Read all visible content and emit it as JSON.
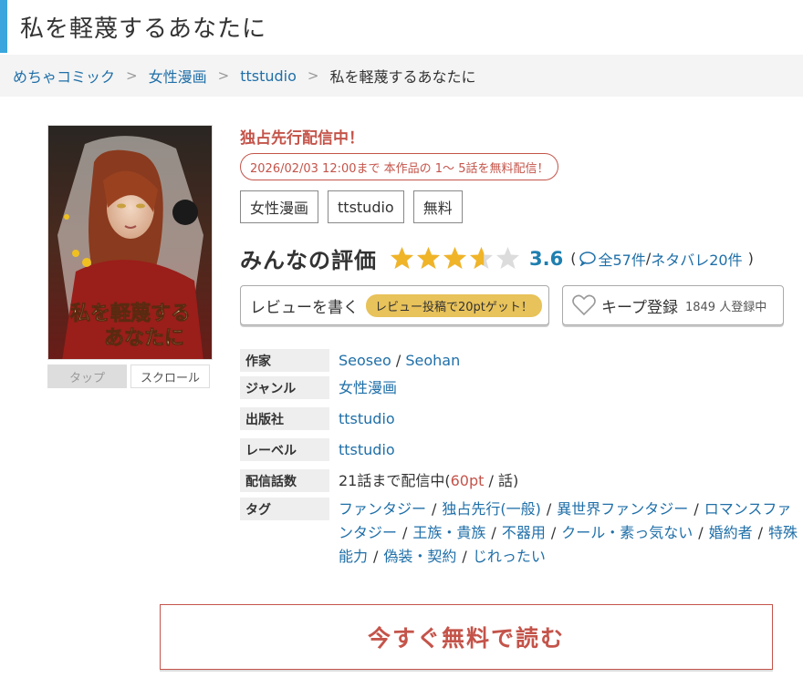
{
  "page_title": "私を軽蔑するあなたに",
  "breadcrumb": {
    "items": [
      "めちゃコミック",
      "女性漫画",
      "ttstudio"
    ],
    "current": "私を軽蔑するあなたに",
    "separator": ">"
  },
  "cover": {
    "title_text": "私を軽蔑するあなたに",
    "mode_tabs": [
      "タップ",
      "スクロール"
    ]
  },
  "exclusive_label": "独占先行配信中！",
  "free_banner": "2026/02/03 12:00まで 本作品の 1～ 5話を無料配信！",
  "category_tags": [
    "女性漫画",
    "ttstudio",
    "無料"
  ],
  "rating": {
    "label": "みんなの評価",
    "score": "3.6",
    "score_value": 3.6,
    "max": 5,
    "open_paren": "(",
    "total_reviews": "全57件",
    "divider": "/",
    "spoiler_reviews": "ネタバレ20件",
    "close_paren": ")"
  },
  "review_button": {
    "label": "レビューを書く",
    "promo": "レビュー投稿で20ptゲット！"
  },
  "keep_button": {
    "label": "キープ登録",
    "count": "1849 人登録中"
  },
  "info": {
    "author_key": "作家",
    "authors": [
      "Seoseo",
      "Seohan"
    ],
    "author_sep": "/",
    "genre_key": "ジャンル",
    "genre": "女性漫画",
    "publisher_key": "出版社",
    "publisher": "ttstudio",
    "label_key": "レーベル",
    "label": "ttstudio",
    "episodes_key": "配信話数",
    "episodes_prefix": "21話まで配信中(",
    "price": "60pt",
    "episodes_suffix": " / 話)",
    "tags_key": "タグ",
    "tags": [
      "ファンタジー",
      "独占先行(一般)",
      "異世界ファンタジー",
      "ロマンスファンタジー",
      "王族・貴族",
      "不器用",
      "クール・素っ気ない",
      "婚約者",
      "特殊能力",
      "偽装・契約",
      "じれったい"
    ],
    "tag_sep": "/"
  },
  "read_button": "今すぐ無料で読む",
  "colors": {
    "accent_blue": "#3aa6dd",
    "link": "#1f6fa8",
    "red": "#c4544a",
    "star": "#f0b429",
    "promo_bg": "#e8c25a"
  }
}
